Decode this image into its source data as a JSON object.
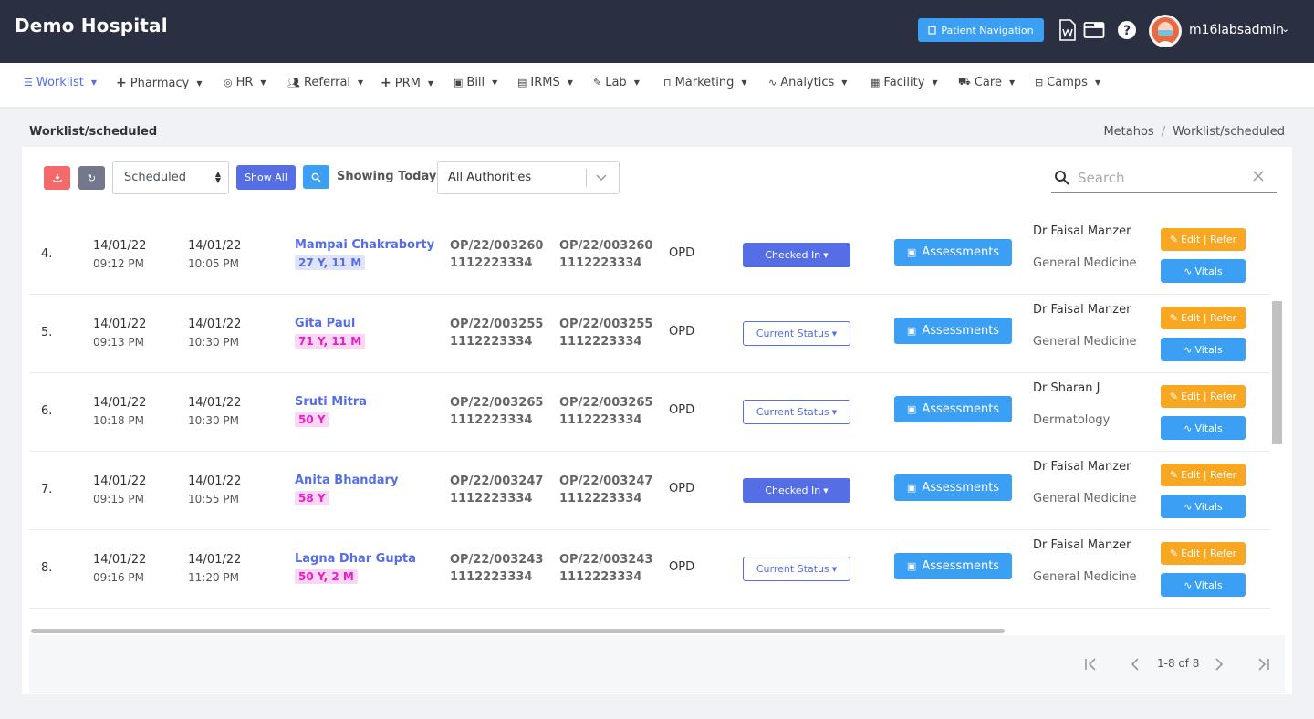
{
  "header": {
    "brand": "Demo Hospital",
    "patient_nav_label": "Patient Navigation",
    "username": "m16labsadmin",
    "colors": {
      "topbar": "#2a3042",
      "accent": "#556ee6",
      "info": "#3b9ff3",
      "warning": "#f8a722",
      "danger": "#f46a6a"
    }
  },
  "nav": {
    "items": [
      {
        "label": "Worklist",
        "icon": "list-icon"
      },
      {
        "label": "Pharmacy",
        "icon": "plus-icon"
      },
      {
        "label": "HR",
        "icon": "user-circle-icon"
      },
      {
        "label": "Referral",
        "icon": "users-icon"
      },
      {
        "label": "PRM",
        "icon": "plus-icon"
      },
      {
        "label": "Bill",
        "icon": "bill-icon"
      },
      {
        "label": "IRMS",
        "icon": "id-card-icon"
      },
      {
        "label": "Lab",
        "icon": "pencil-icon"
      },
      {
        "label": "Marketing",
        "icon": "bag-icon"
      },
      {
        "label": "Analytics",
        "icon": "pulse-icon"
      },
      {
        "label": "Facility",
        "icon": "building-icon"
      },
      {
        "label": "Care",
        "icon": "ambulance-icon"
      },
      {
        "label": "Camps",
        "icon": "briefcase-icon"
      }
    ]
  },
  "page": {
    "title": "Worklist/scheduled",
    "breadcrumb": [
      "Metahos",
      "Worklist/scheduled"
    ]
  },
  "toolbar": {
    "schedule_select": "Scheduled",
    "show_all_label": "Show All",
    "showing_label": "Showing Today",
    "authority_select": "All Authorities",
    "search_placeholder": "Search"
  },
  "rows": [
    {
      "num": "4.",
      "date1": "14/01/22",
      "time1": "09:12 PM",
      "date2": "14/01/22",
      "time2": "10:05 PM",
      "name": "Mampai Chakraborty",
      "age": "27 Y, 11 M",
      "age_style": "blue",
      "op1": "OP/22/003260",
      "ph1": "1112223334",
      "op2": "OP/22/003260",
      "ph2": "1112223334",
      "type": "OPD",
      "status": "Checked In",
      "status_style": "checked",
      "assess": "Assessments",
      "doctor": "Dr Faisal Manzer",
      "dept": "General Medicine",
      "edit": "Edit | Refer",
      "vitals": "Vitals"
    },
    {
      "num": "5.",
      "date1": "14/01/22",
      "time1": "09:13 PM",
      "date2": "14/01/22",
      "time2": "10:30 PM",
      "name": "Gita Paul",
      "age": "71 Y, 11 M",
      "age_style": "pink",
      "op1": "OP/22/003255",
      "ph1": "1112223334",
      "op2": "OP/22/003255",
      "ph2": "1112223334",
      "type": "OPD",
      "status": "Current Status",
      "status_style": "current",
      "assess": "Assessments",
      "doctor": "Dr Faisal Manzer",
      "dept": "General Medicine",
      "edit": "Edit | Refer",
      "vitals": "Vitals"
    },
    {
      "num": "6.",
      "date1": "14/01/22",
      "time1": "10:18 PM",
      "date2": "14/01/22",
      "time2": "10:30 PM",
      "name": "Sruti Mitra",
      "age": "50 Y",
      "age_style": "pink",
      "op1": "OP/22/003265",
      "ph1": "1112223334",
      "op2": "OP/22/003265",
      "ph2": "1112223334",
      "type": "OPD",
      "status": "Current Status",
      "status_style": "current",
      "assess": "Assessments",
      "doctor": "Dr Sharan J",
      "dept": "Dermatology",
      "edit": "Edit | Refer",
      "vitals": "Vitals"
    },
    {
      "num": "7.",
      "date1": "14/01/22",
      "time1": "09:15 PM",
      "date2": "14/01/22",
      "time2": "10:55 PM",
      "name": "Anita Bhandary",
      "age": "58 Y",
      "age_style": "pink",
      "op1": "OP/22/003247",
      "ph1": "1112223334",
      "op2": "OP/22/003247",
      "ph2": "1112223334",
      "type": "OPD",
      "status": "Checked In",
      "status_style": "checked",
      "assess": "Assessments",
      "doctor": "Dr Faisal Manzer",
      "dept": "General Medicine",
      "edit": "Edit | Refer",
      "vitals": "Vitals"
    },
    {
      "num": "8.",
      "date1": "14/01/22",
      "time1": "09:16 PM",
      "date2": "14/01/22",
      "time2": "11:20 PM",
      "name": "Lagna Dhar Gupta",
      "age": "50 Y, 2 M",
      "age_style": "pink",
      "op1": "OP/22/003243",
      "ph1": "1112223334",
      "op2": "OP/22/003243",
      "ph2": "1112223334",
      "type": "OPD",
      "status": "Current Status",
      "status_style": "current",
      "assess": "Assessments",
      "doctor": "Dr Faisal Manzer",
      "dept": "General Medicine",
      "edit": "Edit | Refer",
      "vitals": "Vitals"
    }
  ],
  "pagination": {
    "label": "1-8 of 8"
  }
}
